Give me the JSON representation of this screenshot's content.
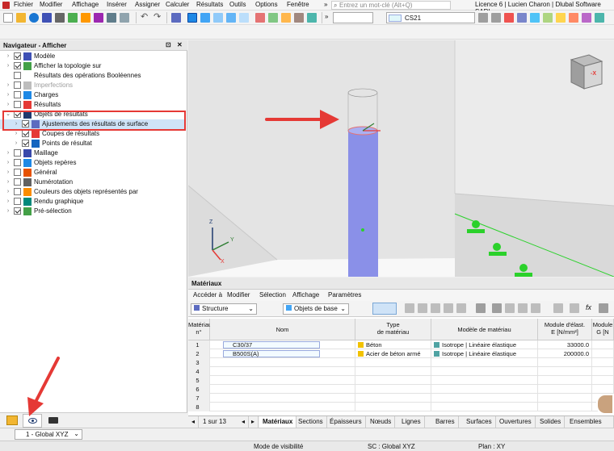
{
  "menu": {
    "items": [
      "Fichier",
      "Modifier",
      "Affichage",
      "Insérer",
      "Assigner",
      "Calculer",
      "Résultats",
      "Outils",
      "Options",
      "Fenêtre"
    ],
    "search_placeholder": "Entrez un mot-clé (Alt+Q)",
    "license": "Licence 6 | Lucien Charon | Dlubal Software SARL"
  },
  "toolbar": {
    "load_case": "CS21"
  },
  "navigator": {
    "title": "Navigateur - Afficher",
    "items": [
      {
        "label": "Modèle",
        "level": 0,
        "chev": "›",
        "checked": true,
        "icon": "model-icon"
      },
      {
        "label": "Afficher la topologie sur",
        "level": 0,
        "chev": "›",
        "checked": true,
        "icon": "topology-icon"
      },
      {
        "label": "Résultats des opérations Booléennes",
        "level": 0,
        "chev": "",
        "checked": false,
        "icon": ""
      },
      {
        "label": "Imperfections",
        "level": 0,
        "chev": "›",
        "checked": false,
        "icon": "imperfection-icon",
        "grey": true
      },
      {
        "label": "Charges",
        "level": 0,
        "chev": "›",
        "checked": false,
        "icon": "loads-icon"
      },
      {
        "label": "Résultats",
        "level": 0,
        "chev": "›",
        "checked": false,
        "icon": "results-icon"
      },
      {
        "label": "Objets de résultats",
        "level": 0,
        "chev": "⌄",
        "checked": true,
        "icon": "result-objects-icon"
      },
      {
        "label": "Ajustements des résultats de surface",
        "level": 1,
        "chev": "›",
        "checked": true,
        "icon": "surface-adjust-icon",
        "selected": true
      },
      {
        "label": "Coupes de résultats",
        "level": 1,
        "chev": "›",
        "checked": true,
        "icon": "result-sections-icon"
      },
      {
        "label": "Points de résultat",
        "level": 1,
        "chev": "›",
        "checked": true,
        "icon": "result-points-icon"
      },
      {
        "label": "Maillage",
        "level": 0,
        "chev": "›",
        "checked": false,
        "icon": "mesh-icon"
      },
      {
        "label": "Objets repères",
        "level": 0,
        "chev": "›",
        "checked": false,
        "icon": "guide-objects-icon"
      },
      {
        "label": "Général",
        "level": 0,
        "chev": "›",
        "checked": false,
        "icon": "general-icon"
      },
      {
        "label": "Numérotation",
        "level": 0,
        "chev": "›",
        "checked": false,
        "icon": "numbering-icon"
      },
      {
        "label": "Couleurs des objets représentés par",
        "level": 0,
        "chev": "›",
        "checked": false,
        "icon": "colors-icon"
      },
      {
        "label": "Rendu graphique",
        "level": 0,
        "chev": "›",
        "checked": false,
        "icon": "render-icon"
      },
      {
        "label": "Pré-sélection",
        "level": 0,
        "chev": "›",
        "checked": true,
        "icon": "preselection-icon"
      }
    ]
  },
  "materials": {
    "title": "Matériaux",
    "menu": [
      "Accéder à",
      "Modifier",
      "Sélection",
      "Affichage",
      "Paramètres"
    ],
    "filter1": "Structure",
    "filter2": "Objets de base",
    "headers": {
      "no": "Matériau\nn°",
      "name": "Nom",
      "type": "Type\nde matériau",
      "model": "Modèle de matériau",
      "e": "Module d'élast.\nE [N/mm²]",
      "g": "Module\nG [N"
    },
    "rows": [
      {
        "no": "1",
        "name": "C30/37",
        "type": "Béton",
        "type_color": "#f2c200",
        "model": "Isotrope | Linéaire élastique",
        "e": "33000.0"
      },
      {
        "no": "2",
        "name": "B500S(A)",
        "type": "Acier de béton armé",
        "type_color": "#f2c200",
        "model": "Isotrope | Linéaire élastique",
        "e": "200000.0"
      },
      {
        "no": "3"
      },
      {
        "no": "4"
      },
      {
        "no": "5"
      },
      {
        "no": "6"
      },
      {
        "no": "7"
      },
      {
        "no": "8"
      }
    ],
    "pager": "1 sur 13",
    "tabs": [
      "Matériaux",
      "Sections",
      "Épaisseurs",
      "Nœuds",
      "Lignes",
      "Barres",
      "Surfaces",
      "Ouvertures",
      "Solides",
      "Ensembles de"
    ]
  },
  "viewport": {
    "axis_x": "X",
    "axis_y": "Y",
    "axis_z": "Z",
    "cube_label": "-X"
  },
  "bottom": {
    "cs": "1 - Global XYZ"
  },
  "status": {
    "visibility": "Mode de visibilité",
    "sc": "SC : Global XYZ",
    "plan": "Plan : XY"
  },
  "colors": {
    "column": "#8a90e8",
    "accent": "#e53935",
    "support": "#2bd12b"
  }
}
